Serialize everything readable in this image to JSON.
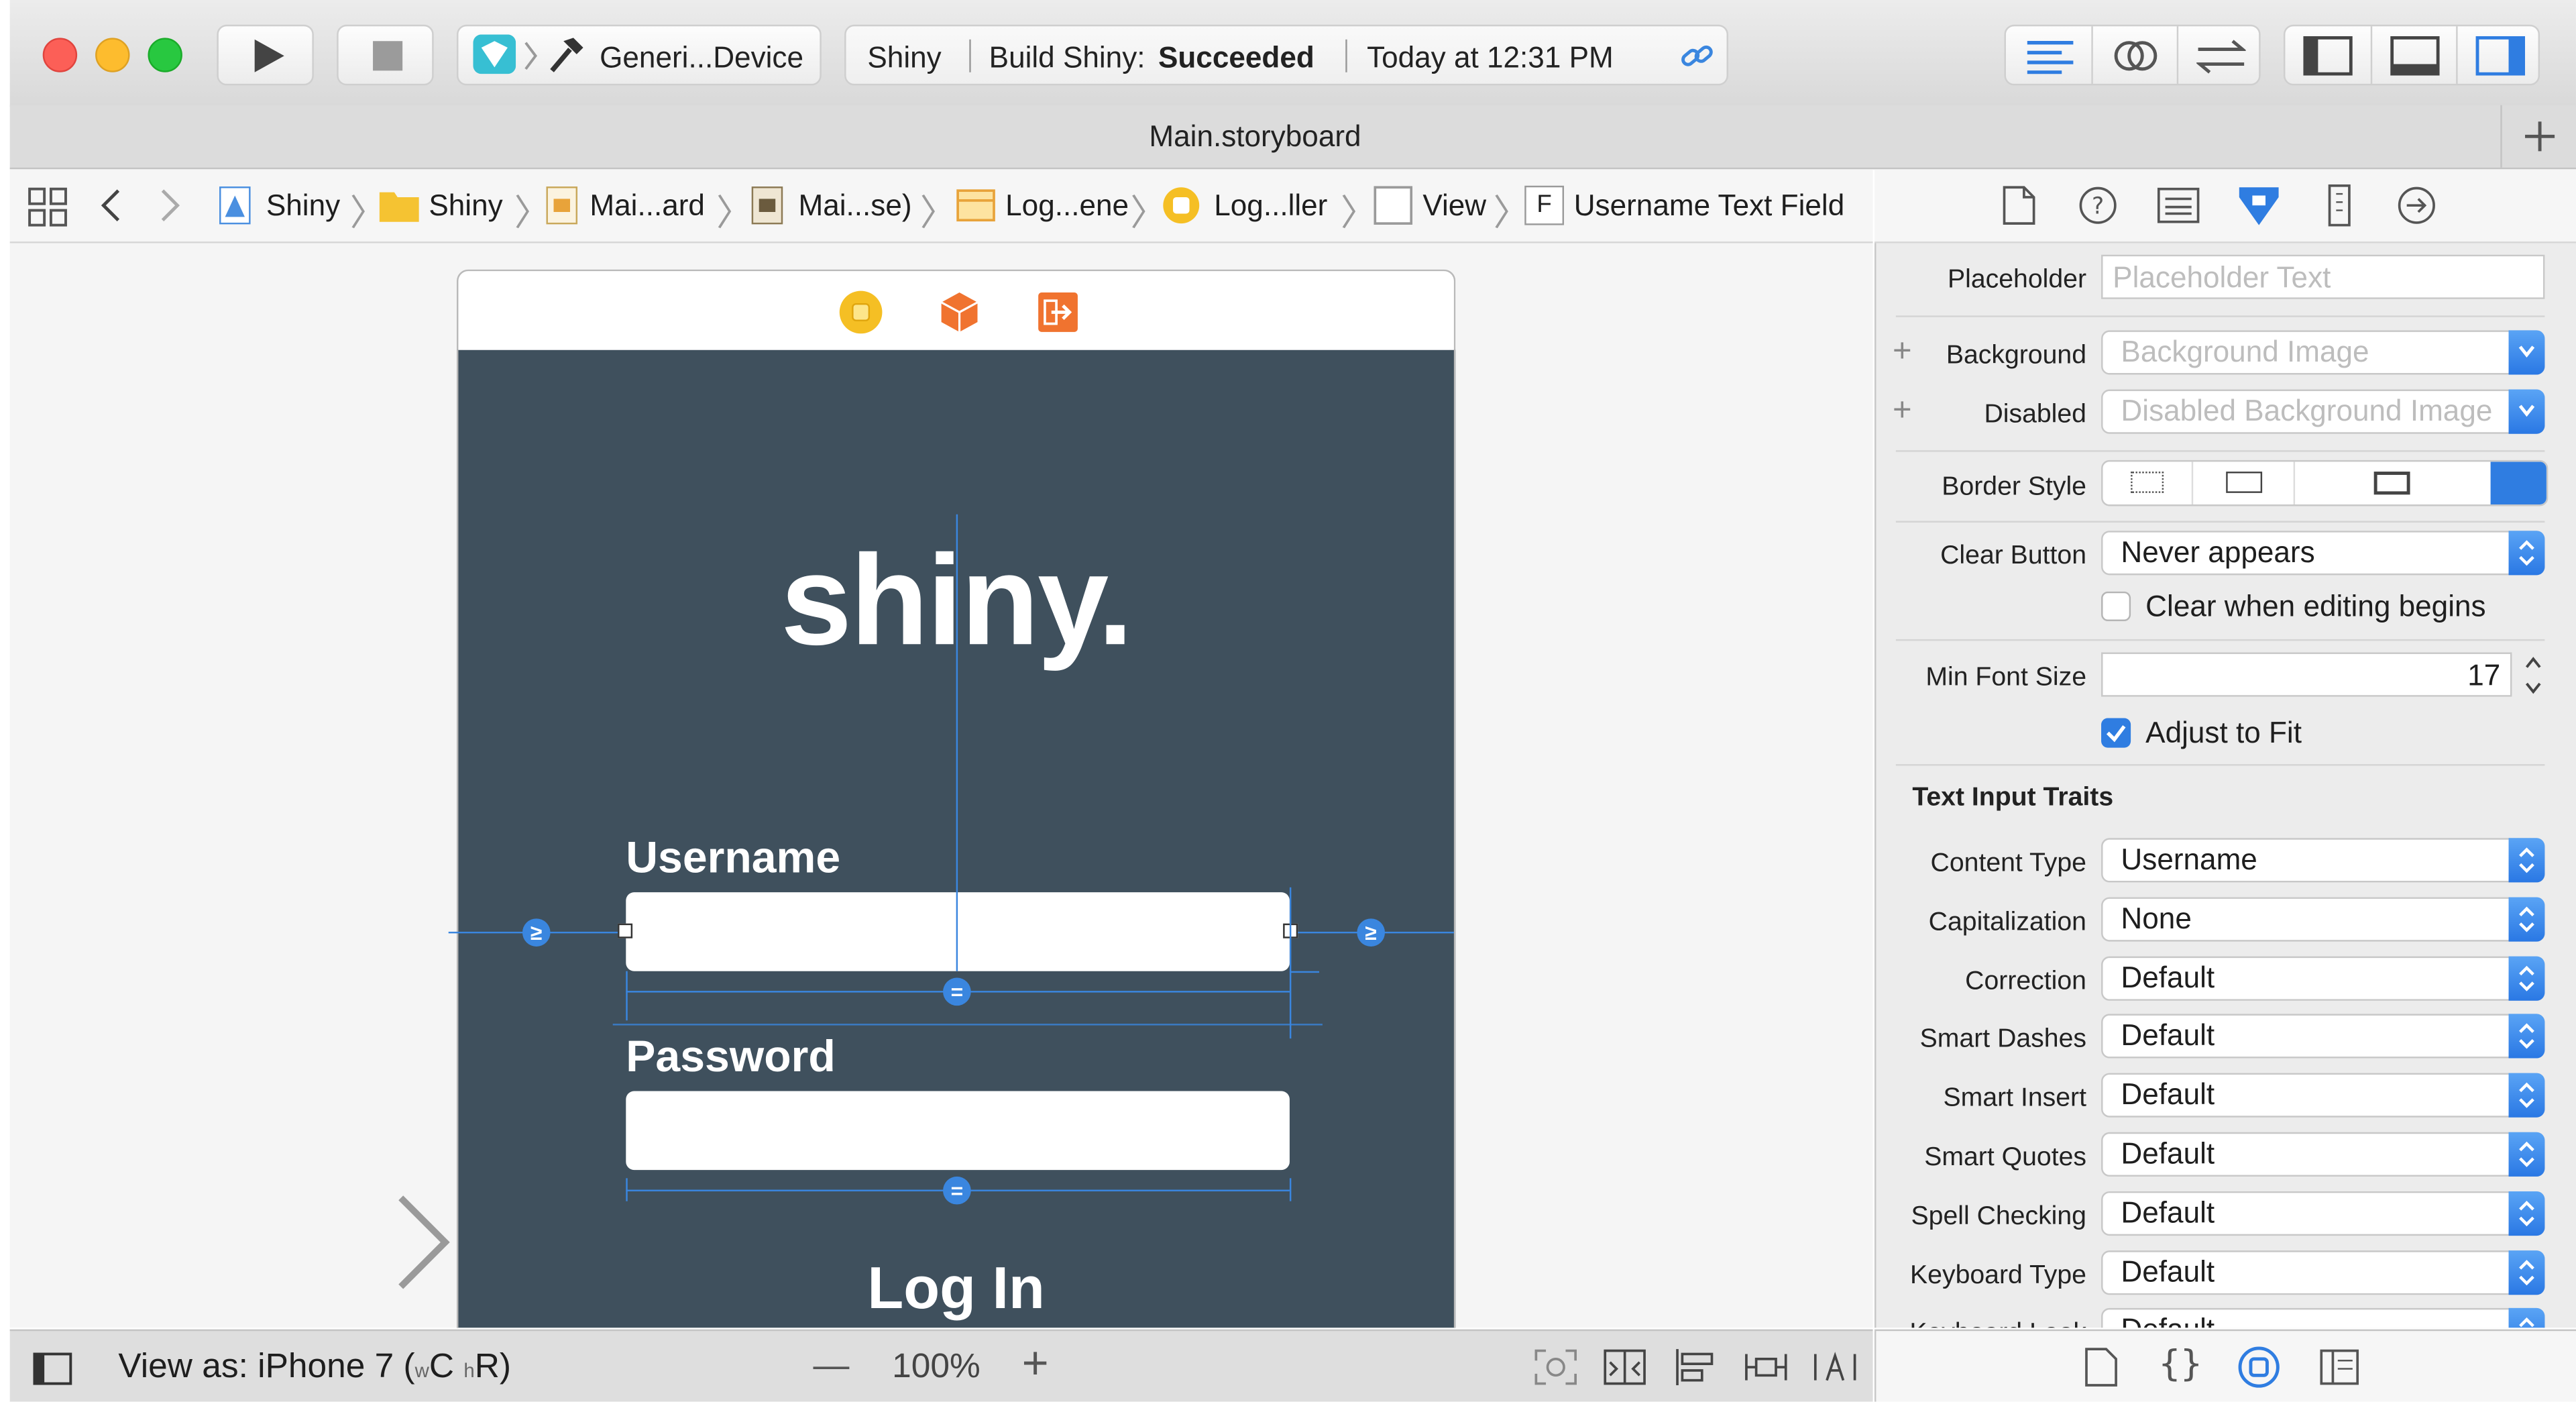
{
  "toolbar": {
    "scheme": "Generi...Device",
    "activity_app": "Shiny",
    "activity_status_prefix": "Build Shiny:",
    "activity_status": "Succeeded",
    "activity_time": "Today at 12:31 PM"
  },
  "tab": {
    "title": "Main.storyboard"
  },
  "jumpbar": {
    "crumbs": [
      "Shiny",
      "Shiny",
      "Mai...ard",
      "Mai...se)",
      "Log...ene",
      "Log...ller",
      "View",
      "Username Text Field"
    ],
    "field_glyph": "F"
  },
  "canvas": {
    "logo_text": "shiny.",
    "username_label": "Username",
    "password_label": "Password",
    "login_button": "Log In",
    "constraint_ge": "≥",
    "constraint_eq": "="
  },
  "inspector": {
    "placeholder_label": "Placeholder",
    "placeholder_hint": "Placeholder Text",
    "background_label": "Background",
    "background_hint": "Background Image",
    "disabled_label": "Disabled",
    "disabled_hint": "Disabled Background Image",
    "plus": "+",
    "border_style_label": "Border Style",
    "clear_button_label": "Clear Button",
    "clear_button_value": "Never appears",
    "clear_when_editing": "Clear when editing begins",
    "clear_when_editing_checked": false,
    "min_font_size_label": "Min Font Size",
    "min_font_size_value": "17",
    "adjust_to_fit": "Adjust to Fit",
    "adjust_to_fit_checked": true,
    "section_title": "Text Input Traits",
    "traits": [
      {
        "label": "Content Type",
        "value": "Username"
      },
      {
        "label": "Capitalization",
        "value": "None"
      },
      {
        "label": "Correction",
        "value": "Default"
      },
      {
        "label": "Smart Dashes",
        "value": "Default"
      },
      {
        "label": "Smart Insert",
        "value": "Default"
      },
      {
        "label": "Smart Quotes",
        "value": "Default"
      },
      {
        "label": "Spell Checking",
        "value": "Default"
      },
      {
        "label": "Keyboard Type",
        "value": "Default"
      },
      {
        "label": "Keyboard Look",
        "value": "Default"
      }
    ]
  },
  "bottombar": {
    "view_as": "View as: iPhone 7 (",
    "size_w": "w",
    "size_c": "C",
    "size_h": "h",
    "size_r": "R)",
    "zoom": "100%",
    "zoom_minus": "—",
    "zoom_plus": "+"
  },
  "colors": {
    "accent": "#2f7de1",
    "canvas_view": "#3f505d",
    "close": "#fc5f57",
    "minimize": "#fdbc2e",
    "zoom": "#28c840",
    "scene_yellow": "#f5bf24",
    "scene_orange": "#f0732f"
  }
}
